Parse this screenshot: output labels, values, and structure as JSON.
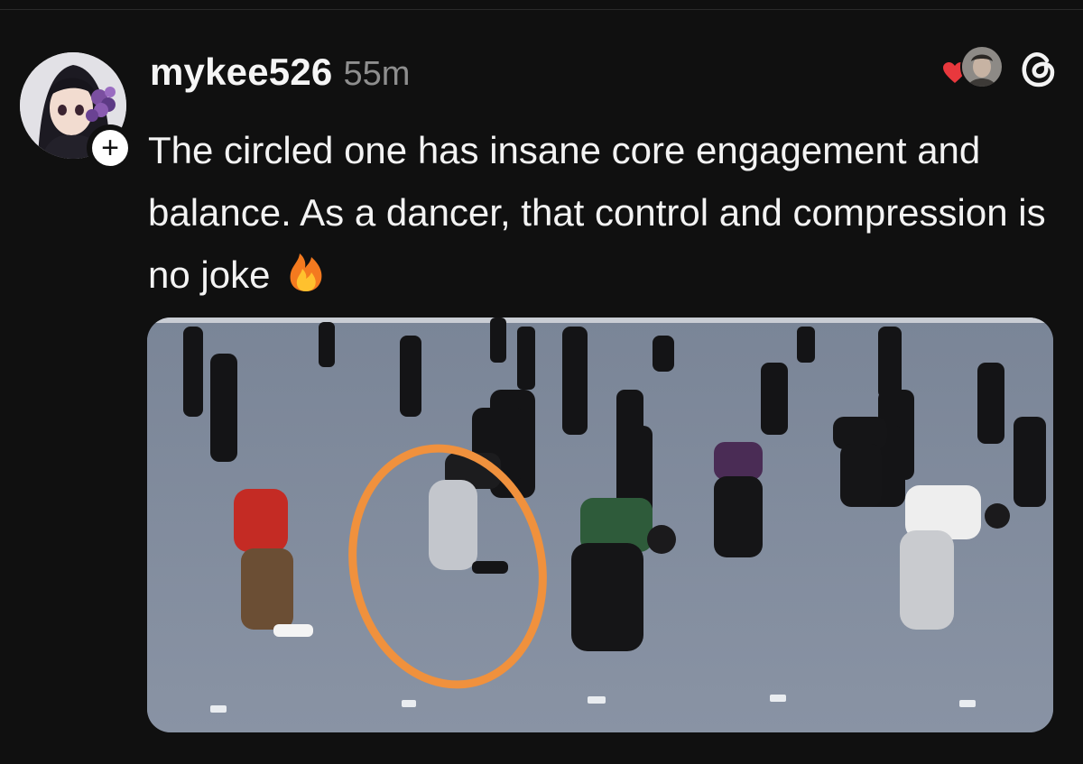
{
  "post": {
    "username": "mykee526",
    "time": "55m",
    "text": "The circled one has insane core engagement and balance. As a dancer, that control and compression is no joke",
    "emoji": "fire-emoji"
  },
  "actions": {
    "follow_symbol": "+",
    "liked_indicator": "heart-icon",
    "app_icon": "threads-logo-icon"
  },
  "media": {
    "description_icons": [
      "floor-marker-1",
      "floor-marker-2",
      "floor-marker-3",
      "floor-marker-4",
      "floor-marker-5"
    ],
    "highlight_color": "#f0913d"
  },
  "colors": {
    "background": "#101010",
    "text": "#f3f3f3",
    "muted": "#8e8e8e",
    "heart": "#e8383d"
  }
}
